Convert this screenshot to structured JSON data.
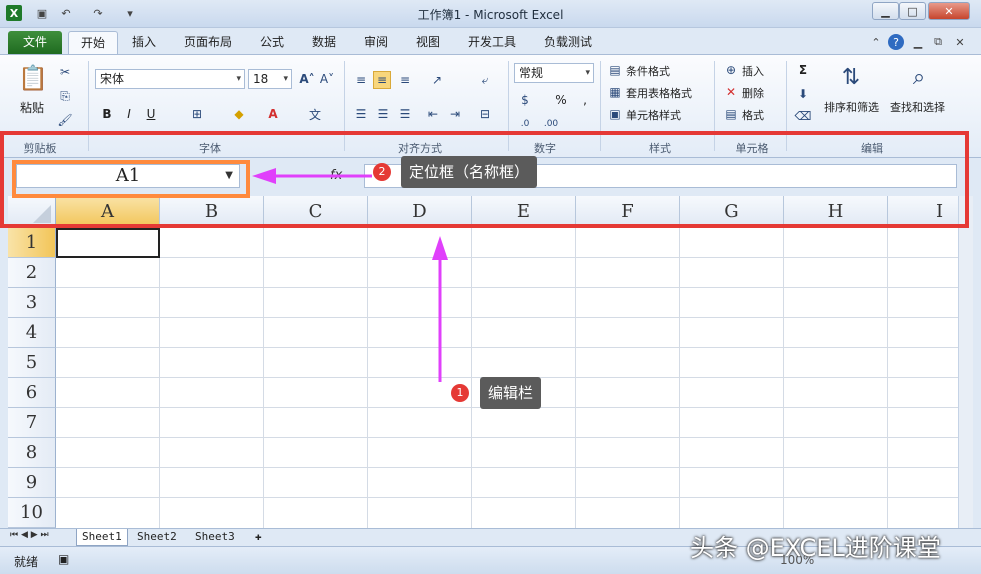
{
  "window": {
    "title": "工作簿1 - Microsoft Excel"
  },
  "tabs": [
    "文件",
    "开始",
    "插入",
    "页面布局",
    "公式",
    "数据",
    "审阅",
    "视图",
    "开发工具",
    "负载测试"
  ],
  "ribbon": {
    "clipboard": {
      "paste": "粘贴",
      "label": "剪贴板"
    },
    "font": {
      "name": "宋体",
      "size": "18",
      "label": "字体",
      "bold": "B",
      "italic": "I",
      "underline": "U"
    },
    "alignment": {
      "label": "对齐方式"
    },
    "number": {
      "format": "常规",
      "percent": "%",
      "comma": ",",
      "label": "数字"
    },
    "styles": {
      "cond": "条件格式",
      "table": "套用表格格式",
      "cell": "单元格样式",
      "label": "样式"
    },
    "cells": {
      "insert": "插入",
      "delete": "删除",
      "format": "格式",
      "label": "单元格"
    },
    "editing": {
      "sigma": "Σ",
      "sort": "排序和筛选",
      "find": "查找和选择",
      "label": "编辑"
    }
  },
  "formula_bar": {
    "name_box": "A1",
    "fx": "fx"
  },
  "columns": [
    "A",
    "B",
    "C",
    "D",
    "E",
    "F",
    "G",
    "H",
    "I"
  ],
  "rows": [
    "1",
    "2",
    "3",
    "4",
    "5",
    "6",
    "7",
    "8",
    "9",
    "10"
  ],
  "sheets": [
    "Sheet1",
    "Sheet2",
    "Sheet3"
  ],
  "status": {
    "ready": "就绪",
    "zoom": "100%"
  },
  "annotations": {
    "badge1": "1",
    "label1": "编辑栏",
    "badge2": "2",
    "label2": "定位框（名称框）"
  },
  "watermark": "头条 @EXCEL进阶课堂",
  "colors": {
    "accent_red": "#e53935",
    "accent_orange": "#ff8a3d",
    "arrow": "#e040fb",
    "file_tab": "#2e7d32"
  }
}
